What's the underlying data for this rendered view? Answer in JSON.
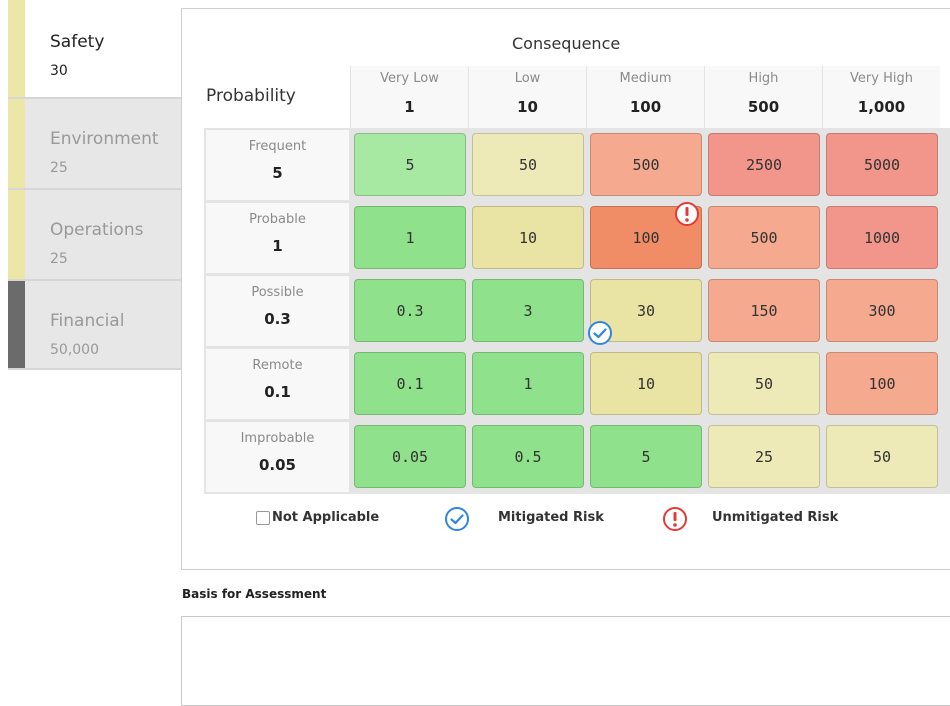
{
  "tabs": [
    {
      "name": "Safety",
      "value": "30",
      "active": true
    },
    {
      "name": "Environment",
      "value": "25"
    },
    {
      "name": "Operations",
      "value": "25"
    },
    {
      "name": "Financial",
      "value": "50,000"
    }
  ],
  "matrix": {
    "consequence_title": "Consequence",
    "probability_title": "Probability",
    "columns": [
      {
        "label": "Very Low",
        "value": "1"
      },
      {
        "label": "Low",
        "value": "10"
      },
      {
        "label": "Medium",
        "value": "100"
      },
      {
        "label": "High",
        "value": "500"
      },
      {
        "label": "Very High",
        "value": "1,000"
      }
    ],
    "rows": [
      {
        "label": "Frequent",
        "value": "5",
        "cells": [
          "5",
          "50",
          "500",
          "2500",
          "5000"
        ]
      },
      {
        "label": "Probable",
        "value": "1",
        "cells": [
          "1",
          "10",
          "100",
          "500",
          "1000"
        ]
      },
      {
        "label": "Possible",
        "value": "0.3",
        "cells": [
          "0.3",
          "3",
          "30",
          "150",
          "300"
        ]
      },
      {
        "label": "Remote",
        "value": "0.1",
        "cells": [
          "0.1",
          "1",
          "10",
          "50",
          "100"
        ]
      },
      {
        "label": "Improbable",
        "value": "0.05",
        "cells": [
          "0.05",
          "0.5",
          "5",
          "25",
          "50"
        ]
      }
    ],
    "unmitigated_cell": {
      "row": "Probable",
      "column": "Medium"
    },
    "mitigated_cell": {
      "row": "Possible",
      "column": "Medium"
    }
  },
  "legend": {
    "not_applicable": "Not Applicable",
    "mitigated": "Mitigated Risk",
    "unmitigated": "Unmitigated Risk"
  },
  "basis": {
    "label": "Basis for Assessment",
    "value": ""
  },
  "colors": {
    "mitigated_icon": "#2e86de",
    "unmitigated_icon": "#e53935",
    "active_tab_accent": "#ece6a7",
    "financial_tab_accent": "#6b6b6b"
  }
}
